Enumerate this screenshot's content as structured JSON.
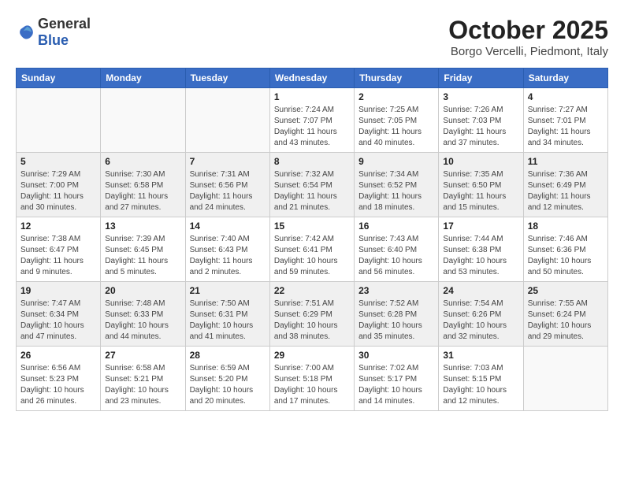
{
  "header": {
    "logo_general": "General",
    "logo_blue": "Blue",
    "month_title": "October 2025",
    "subtitle": "Borgo Vercelli, Piedmont, Italy"
  },
  "days_of_week": [
    "Sunday",
    "Monday",
    "Tuesday",
    "Wednesday",
    "Thursday",
    "Friday",
    "Saturday"
  ],
  "weeks": [
    {
      "shade": false,
      "days": [
        {
          "num": "",
          "info": ""
        },
        {
          "num": "",
          "info": ""
        },
        {
          "num": "",
          "info": ""
        },
        {
          "num": "1",
          "info": "Sunrise: 7:24 AM\nSunset: 7:07 PM\nDaylight: 11 hours\nand 43 minutes."
        },
        {
          "num": "2",
          "info": "Sunrise: 7:25 AM\nSunset: 7:05 PM\nDaylight: 11 hours\nand 40 minutes."
        },
        {
          "num": "3",
          "info": "Sunrise: 7:26 AM\nSunset: 7:03 PM\nDaylight: 11 hours\nand 37 minutes."
        },
        {
          "num": "4",
          "info": "Sunrise: 7:27 AM\nSunset: 7:01 PM\nDaylight: 11 hours\nand 34 minutes."
        }
      ]
    },
    {
      "shade": true,
      "days": [
        {
          "num": "5",
          "info": "Sunrise: 7:29 AM\nSunset: 7:00 PM\nDaylight: 11 hours\nand 30 minutes."
        },
        {
          "num": "6",
          "info": "Sunrise: 7:30 AM\nSunset: 6:58 PM\nDaylight: 11 hours\nand 27 minutes."
        },
        {
          "num": "7",
          "info": "Sunrise: 7:31 AM\nSunset: 6:56 PM\nDaylight: 11 hours\nand 24 minutes."
        },
        {
          "num": "8",
          "info": "Sunrise: 7:32 AM\nSunset: 6:54 PM\nDaylight: 11 hours\nand 21 minutes."
        },
        {
          "num": "9",
          "info": "Sunrise: 7:34 AM\nSunset: 6:52 PM\nDaylight: 11 hours\nand 18 minutes."
        },
        {
          "num": "10",
          "info": "Sunrise: 7:35 AM\nSunset: 6:50 PM\nDaylight: 11 hours\nand 15 minutes."
        },
        {
          "num": "11",
          "info": "Sunrise: 7:36 AM\nSunset: 6:49 PM\nDaylight: 11 hours\nand 12 minutes."
        }
      ]
    },
    {
      "shade": false,
      "days": [
        {
          "num": "12",
          "info": "Sunrise: 7:38 AM\nSunset: 6:47 PM\nDaylight: 11 hours\nand 9 minutes."
        },
        {
          "num": "13",
          "info": "Sunrise: 7:39 AM\nSunset: 6:45 PM\nDaylight: 11 hours\nand 5 minutes."
        },
        {
          "num": "14",
          "info": "Sunrise: 7:40 AM\nSunset: 6:43 PM\nDaylight: 11 hours\nand 2 minutes."
        },
        {
          "num": "15",
          "info": "Sunrise: 7:42 AM\nSunset: 6:41 PM\nDaylight: 10 hours\nand 59 minutes."
        },
        {
          "num": "16",
          "info": "Sunrise: 7:43 AM\nSunset: 6:40 PM\nDaylight: 10 hours\nand 56 minutes."
        },
        {
          "num": "17",
          "info": "Sunrise: 7:44 AM\nSunset: 6:38 PM\nDaylight: 10 hours\nand 53 minutes."
        },
        {
          "num": "18",
          "info": "Sunrise: 7:46 AM\nSunset: 6:36 PM\nDaylight: 10 hours\nand 50 minutes."
        }
      ]
    },
    {
      "shade": true,
      "days": [
        {
          "num": "19",
          "info": "Sunrise: 7:47 AM\nSunset: 6:34 PM\nDaylight: 10 hours\nand 47 minutes."
        },
        {
          "num": "20",
          "info": "Sunrise: 7:48 AM\nSunset: 6:33 PM\nDaylight: 10 hours\nand 44 minutes."
        },
        {
          "num": "21",
          "info": "Sunrise: 7:50 AM\nSunset: 6:31 PM\nDaylight: 10 hours\nand 41 minutes."
        },
        {
          "num": "22",
          "info": "Sunrise: 7:51 AM\nSunset: 6:29 PM\nDaylight: 10 hours\nand 38 minutes."
        },
        {
          "num": "23",
          "info": "Sunrise: 7:52 AM\nSunset: 6:28 PM\nDaylight: 10 hours\nand 35 minutes."
        },
        {
          "num": "24",
          "info": "Sunrise: 7:54 AM\nSunset: 6:26 PM\nDaylight: 10 hours\nand 32 minutes."
        },
        {
          "num": "25",
          "info": "Sunrise: 7:55 AM\nSunset: 6:24 PM\nDaylight: 10 hours\nand 29 minutes."
        }
      ]
    },
    {
      "shade": false,
      "days": [
        {
          "num": "26",
          "info": "Sunrise: 6:56 AM\nSunset: 5:23 PM\nDaylight: 10 hours\nand 26 minutes."
        },
        {
          "num": "27",
          "info": "Sunrise: 6:58 AM\nSunset: 5:21 PM\nDaylight: 10 hours\nand 23 minutes."
        },
        {
          "num": "28",
          "info": "Sunrise: 6:59 AM\nSunset: 5:20 PM\nDaylight: 10 hours\nand 20 minutes."
        },
        {
          "num": "29",
          "info": "Sunrise: 7:00 AM\nSunset: 5:18 PM\nDaylight: 10 hours\nand 17 minutes."
        },
        {
          "num": "30",
          "info": "Sunrise: 7:02 AM\nSunset: 5:17 PM\nDaylight: 10 hours\nand 14 minutes."
        },
        {
          "num": "31",
          "info": "Sunrise: 7:03 AM\nSunset: 5:15 PM\nDaylight: 10 hours\nand 12 minutes."
        },
        {
          "num": "",
          "info": ""
        }
      ]
    }
  ]
}
